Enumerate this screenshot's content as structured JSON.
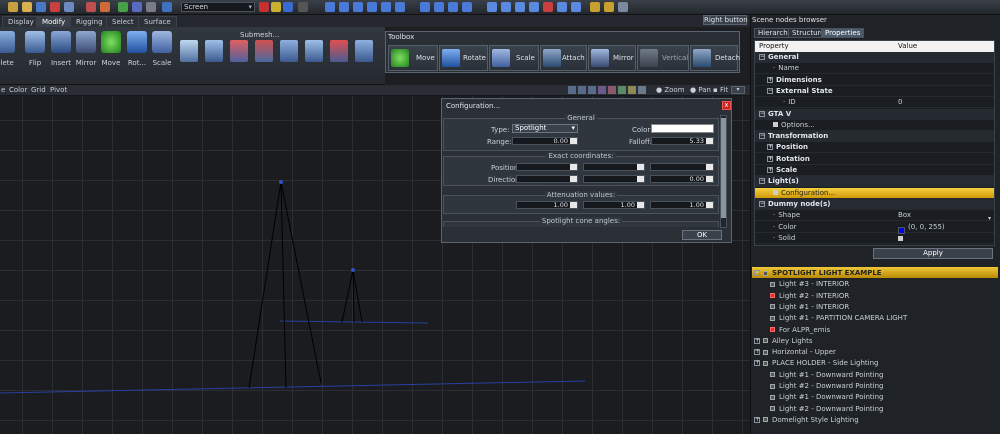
{
  "toolbar": {
    "screen_combo": "Screen"
  },
  "tabs": [
    "Display",
    "Modify",
    "Rigging",
    "Select",
    "Surface"
  ],
  "right_button": "Right button",
  "ribbon": {
    "buttons": [
      "elete",
      "Flip",
      "Insert",
      "Mirror",
      "Move",
      "Rot...",
      "Scale"
    ],
    "submesh_label": "Submesh..."
  },
  "toolbox": {
    "title": "Toolbox",
    "buttons": [
      "Move",
      "Rotate",
      "Scale",
      "Attach",
      "Mirror",
      "Vertical",
      "Detach"
    ]
  },
  "viewport_bar": {
    "menu": [
      "e",
      "Color",
      "Grid",
      "Pivot"
    ],
    "zoom": "Zoom",
    "pan": "Pan",
    "fit": "Fit"
  },
  "config": {
    "title": "Configuration...",
    "close": "x",
    "general": {
      "title": "General",
      "type_label": "Type:",
      "type_value": "Spotlight",
      "color_label": "Color:",
      "range_label": "Range:",
      "range_value": "0.00",
      "falloff_label": "Falloff:",
      "falloff_value": "5.33"
    },
    "exact": {
      "title": "Exact coordinates:",
      "position_label": "Position:",
      "direction_label": "Direction:",
      "direction_value": "0.00"
    },
    "attenuation": {
      "title": "Attenuation values:",
      "values": [
        "1.00",
        "1.00",
        "1.00"
      ]
    },
    "cone": {
      "title": "Spotlight cone angles:"
    },
    "ok": "OK",
    "color_swatch": "#ffffff"
  },
  "panel": {
    "title": "Scene nodes browser",
    "tabs": [
      "Hierarchy",
      "Structure",
      "Properties"
    ],
    "col_property": "Property",
    "col_value": "Value",
    "rows": [
      {
        "name": "General",
        "value": "",
        "kind": "section",
        "marker": "minus"
      },
      {
        "name": "Name",
        "value": "",
        "kind": "leaf"
      },
      {
        "name": "Dimensions",
        "value": "",
        "kind": "group",
        "marker": "plus"
      },
      {
        "name": "External State",
        "value": "",
        "kind": "group",
        "marker": "minus"
      },
      {
        "name": "ID",
        "value": "0",
        "kind": "leaf2"
      },
      {
        "name": "GTA V",
        "value": "",
        "kind": "section",
        "marker": "minus"
      },
      {
        "name": "Options...",
        "value": "",
        "kind": "check"
      },
      {
        "name": "Transformation",
        "value": "",
        "kind": "section",
        "marker": "minus"
      },
      {
        "name": "Position",
        "value": "",
        "kind": "group",
        "marker": "plus"
      },
      {
        "name": "Rotation",
        "value": "",
        "kind": "group",
        "marker": "plus"
      },
      {
        "name": "Scale",
        "value": "",
        "kind": "group",
        "marker": "plus"
      },
      {
        "name": "Light(s)",
        "value": "",
        "kind": "section",
        "marker": "minus"
      },
      {
        "name": "Configuration...",
        "value": "",
        "kind": "selected"
      },
      {
        "name": "Dummy node(s)",
        "value": "",
        "kind": "section",
        "marker": "minus"
      },
      {
        "name": "Shape",
        "value": "Box",
        "kind": "leaf"
      },
      {
        "name": "Color",
        "value": "(0, 0, 255)",
        "kind": "color"
      },
      {
        "name": "Solid",
        "value": "",
        "kind": "leaf"
      }
    ],
    "apply": "Apply",
    "dummy_color": "#0000ff"
  },
  "tree": [
    {
      "label": "SPOTLIGHT LIGHT EXAMPLE",
      "kind": "header"
    },
    {
      "label": "Light #3 - INTERIOR",
      "kind": "child"
    },
    {
      "label": "Light #2 - INTERIOR",
      "kind": "child-red"
    },
    {
      "label": "Light #1 - INTERIOR",
      "kind": "child"
    },
    {
      "label": "Light #1 - PARTITION CAMERA LIGHT",
      "kind": "child"
    },
    {
      "label": "For ALPR_emis",
      "kind": "child-red"
    },
    {
      "label": "Alley Lights",
      "kind": "root"
    },
    {
      "label": "Horizontal - Upper",
      "kind": "root"
    },
    {
      "label": "PLACE HOLDER - Side Lighting",
      "kind": "root"
    },
    {
      "label": "Light #1 - Downward Pointing",
      "kind": "child"
    },
    {
      "label": "Light #2 - Downward Pointing",
      "kind": "child"
    },
    {
      "label": "Light #1 - Downward Pointing",
      "kind": "child"
    },
    {
      "label": "Light #2 - Downward Pointing",
      "kind": "child"
    },
    {
      "label": "Domelight Style Lighting",
      "kind": "root"
    }
  ]
}
